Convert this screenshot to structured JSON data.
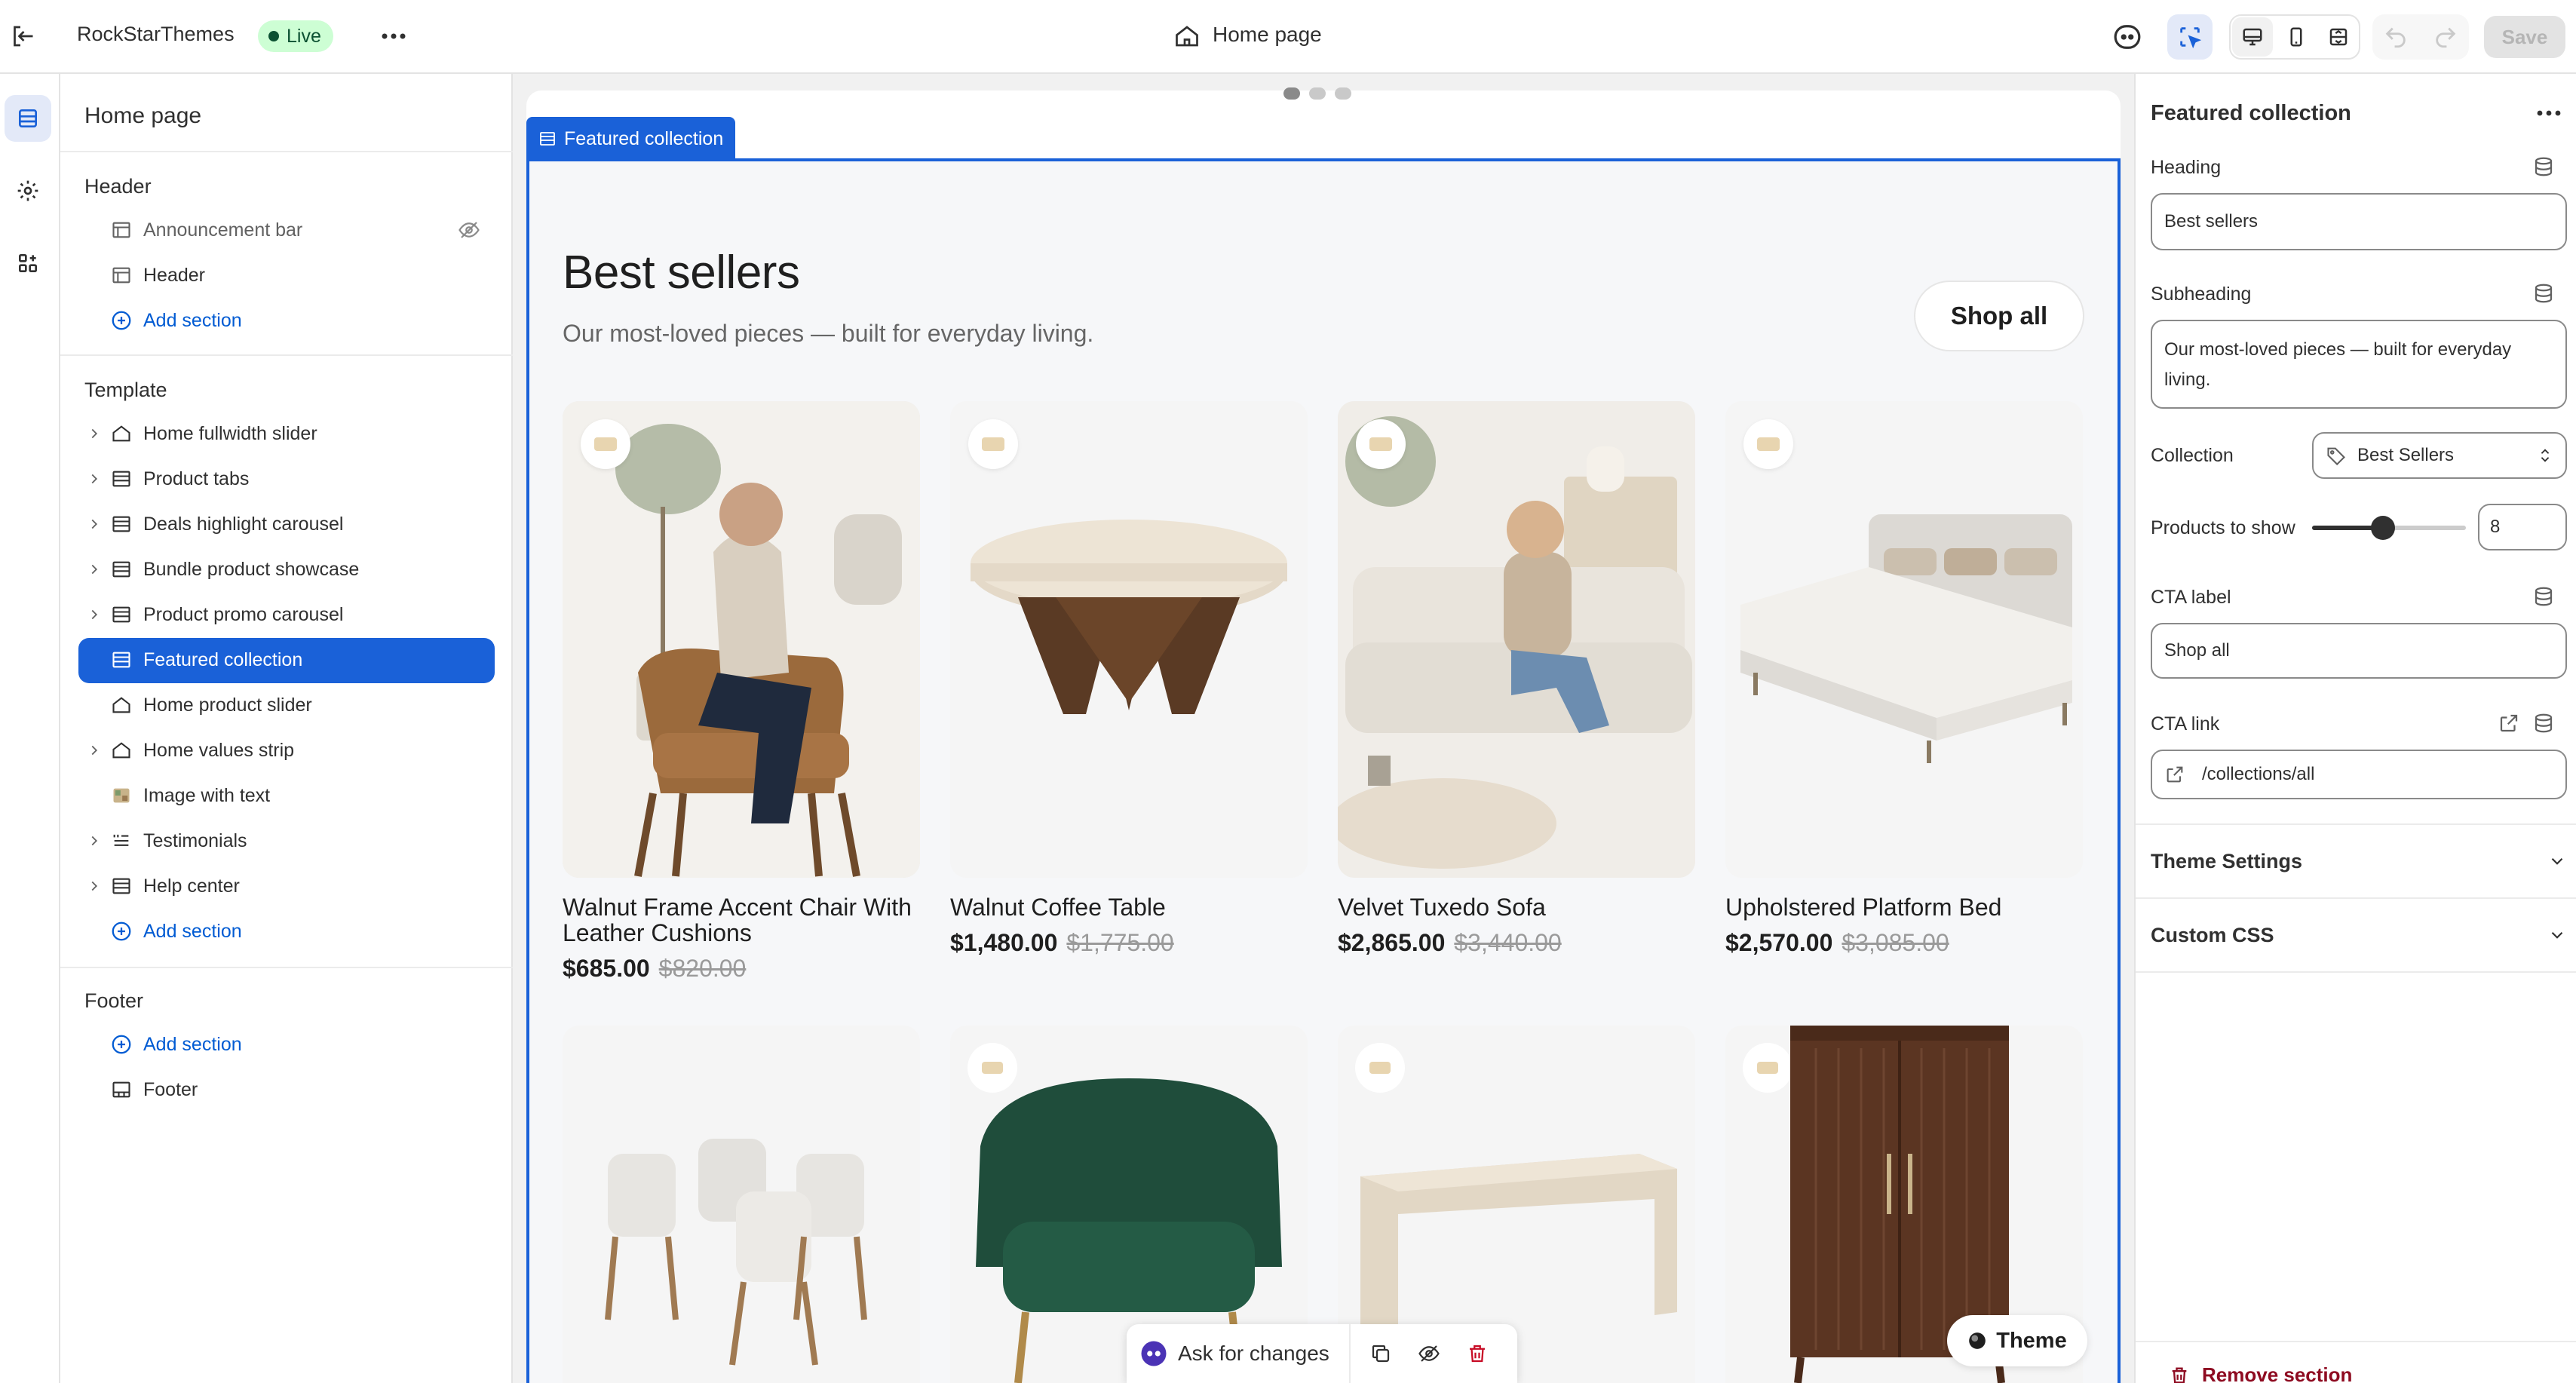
{
  "topbar": {
    "store_name": "RockStarThemes",
    "live_label": "Live",
    "page_name": "Home page",
    "save_label": "Save"
  },
  "sidebar": {
    "title": "Home page",
    "header_group": "Header",
    "header_items": [
      "Announcement bar",
      "Header"
    ],
    "add_section": "Add section",
    "template_group": "Template",
    "template_items": [
      "Home fullwidth slider",
      "Product tabs",
      "Deals highlight carousel",
      "Bundle product showcase",
      "Product promo carousel",
      "Featured collection",
      "Home product slider",
      "Home values strip",
      "Image with text",
      "Testimonials",
      "Help center"
    ],
    "footer_group": "Footer",
    "footer_items": [
      "Footer"
    ]
  },
  "preview": {
    "section_tab": "Featured collection",
    "heading": "Best sellers",
    "subheading": "Our most-loved pieces — built for everyday living.",
    "shop_all": "Shop all",
    "products": [
      {
        "title_line1": "Walnut Frame Accent Chair With",
        "title_line2": "Leather Cushions",
        "price": "$685.00",
        "compare": "$820.00"
      },
      {
        "title_line1": "Walnut Coffee Table",
        "title_line2": "",
        "price": "$1,480.00",
        "compare": "$1,775.00"
      },
      {
        "title_line1": "Velvet Tuxedo Sofa",
        "title_line2": "",
        "price": "$2,865.00",
        "compare": "$3,440.00"
      },
      {
        "title_line1": "Upholstered Platform Bed",
        "title_line2": "",
        "price": "$2,570.00",
        "compare": "$3,085.00"
      }
    ],
    "ask_label": "Ask for changes",
    "theme_label": "Theme"
  },
  "settings": {
    "title": "Featured collection",
    "heading_label": "Heading",
    "heading_value": "Best sellers",
    "subheading_label": "Subheading",
    "subheading_line1": "Our most-loved pieces — built for everyday",
    "subheading_line2": "living.",
    "collection_label": "Collection",
    "collection_value": "Best Sellers",
    "products_label": "Products to show",
    "products_value": "8",
    "products_fill": 0.46,
    "cta_label_label": "CTA label",
    "cta_label_value": "Shop all",
    "cta_link_label": "CTA link",
    "cta_link_value": "/collections/all",
    "theme_settings": "Theme Settings",
    "custom_css": "Custom CSS",
    "remove_section": "Remove section"
  },
  "colors": {
    "accent": "#1a61d8",
    "live_bg": "#cdfed4",
    "danger": "#8e0b21"
  }
}
